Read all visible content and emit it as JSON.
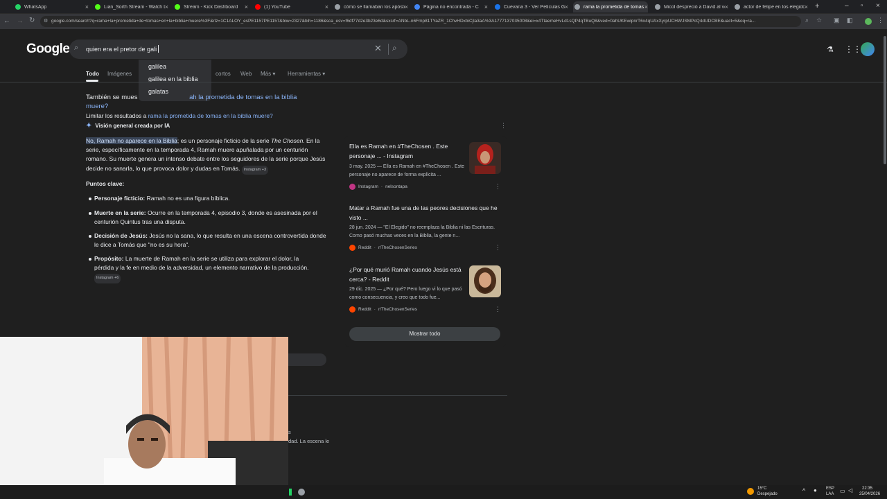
{
  "tabs": [
    {
      "label": "WhatsApp",
      "color": "#25d366"
    },
    {
      "label": "Lian_Sorth Stream - Watch Li",
      "color": "#53fc18"
    },
    {
      "label": "Stream - Kick Dashboard",
      "color": "#53fc18"
    },
    {
      "label": "(1) YouTube",
      "color": "#ff0000"
    },
    {
      "label": "cómo se llamaban los apóstoles",
      "color": "#9aa0a6"
    },
    {
      "label": "Página no encontrada - C",
      "color": "#4285f4"
    },
    {
      "label": "Cuevana 3 - Ver Películas Gra",
      "color": "#1a73e8"
    },
    {
      "label": "rama la prometida de tomas",
      "color": "#9aa0a6"
    },
    {
      "label": "Micol despreció a David al ve",
      "color": "#9aa0a6"
    },
    {
      "label": "actor de felipe en los elegido",
      "color": "#9aa0a6"
    }
  ],
  "address": {
    "url": "google.com/search?q=rama+la+prometida+de+tomas+en+la+biblia+muere%3F&rlz=1C1ALOY_esPE1157PE1157&biw=2327&bih=1186&sca_esv=f6df77d2e3b23e6d&sxsrf=ANbL-n6Fmp81TYaZR_1ChvHDxbiCjla3aA%3A1777137035008&ei=x4TtaemeHvLd1sQP4qTBuQ8&ved=0ahUKEwipnrT6x4qUAxXyrpUCHWJSMPcQ4dUDCBE&uact=5&oq=ra..."
  },
  "search": {
    "logo": "Google",
    "query": "quien era el pretor de gali",
    "suggestions": [
      "galilea",
      "galilea en la biblia",
      "galatas"
    ]
  },
  "nav": {
    "tabs": [
      "Todo",
      "Imágenes",
      "cortos",
      "Web",
      "Más ▾",
      "Herramientas ▾"
    ]
  },
  "results": {
    "also_shown_prefix": "También se mues",
    "also_shown_link": "ah la prometida de tomas en la biblia",
    "also_shown_link2": "muere?",
    "limit_prefix": "Limitar los resultados a ",
    "limit_link": "rama la prometida de tomas en la biblia muere?",
    "ai_overview_label": "Visión general creada por IA"
  },
  "ai": {
    "highlight": "No, Ramah no aparece en la Biblia",
    "p1_a": "; es un personaje ficticio de la serie ",
    "p1_italic": "The Chosen",
    "p1_b": ". En la serie, específicamente en la temporada 4, Ramah muere apuñalada por un centurión romano. Su muerte genera un intenso debate entre los seguidores de la serie porque Jesús decide no sanarla, lo que provoca dolor y dudas en Tomás.",
    "p1_src": "Instagram +3",
    "points_title": "Puntos clave:",
    "points": [
      {
        "bold": "Personaje ficticio:",
        "text": " Ramah no es una figura bíblica."
      },
      {
        "bold": "Muerte en la serie:",
        "text": " Ocurre en la temporada 4, episodio 3, donde es asesinada por el centurión Quintus tras una disputa."
      },
      {
        "bold": "Decisión de Jesús:",
        "text": " Jesús no la sana, lo que resulta en una escena controvertida donde le dice a Tomás que \"no es su hora\"."
      },
      {
        "bold": "Propósito:",
        "text": " La muerte de Ramah en la serie se utiliza para explorar el dolor, la pérdida y la fe en medio de la adversidad, un elemento narrativo de la producción.",
        "src": "Instagram +6"
      }
    ],
    "fragment1": "s",
    "fragment2": "dad. La escena le"
  },
  "cards": [
    {
      "title": "Ella es Ramah en #TheChosen . Este personaje ... - Instagram",
      "snippet": "3 may. 2025 — Ella es Ramah en #TheChosen . Este personaje no aparece de forma explícita ...",
      "source": "Instagram",
      "handle": "nelsontapa",
      "icon_color": "#c13584"
    },
    {
      "title": "Matar a Ramah fue una de las peores decisiones que he visto ...",
      "snippet": "28 jun. 2024 — \"El Elegido\" no reemplaza la Biblia ni las Escrituras. Como pasó muchas veces en la Biblia, la gente n...",
      "source": "Reddit",
      "handle": "r/TheChosenSeries",
      "icon_color": "#ff4500"
    },
    {
      "title": "¿Por qué murió Ramah cuando Jesús está cerca? - Reddit",
      "snippet": "29 dic. 2025 — ¿Por qué? Pero luego vi lo que pasó como consecuencia, y creo que todo fue...",
      "source": "Reddit",
      "handle": "r/TheChosenSeries",
      "icon_color": "#ff4500"
    }
  ],
  "show_all": "Mostrar todo",
  "taskbar": {
    "temp": "15°C",
    "weather": "Despejado",
    "lang": "ESP",
    "lang2": "LAA",
    "time": "22:35",
    "date": "25/04/2026"
  }
}
